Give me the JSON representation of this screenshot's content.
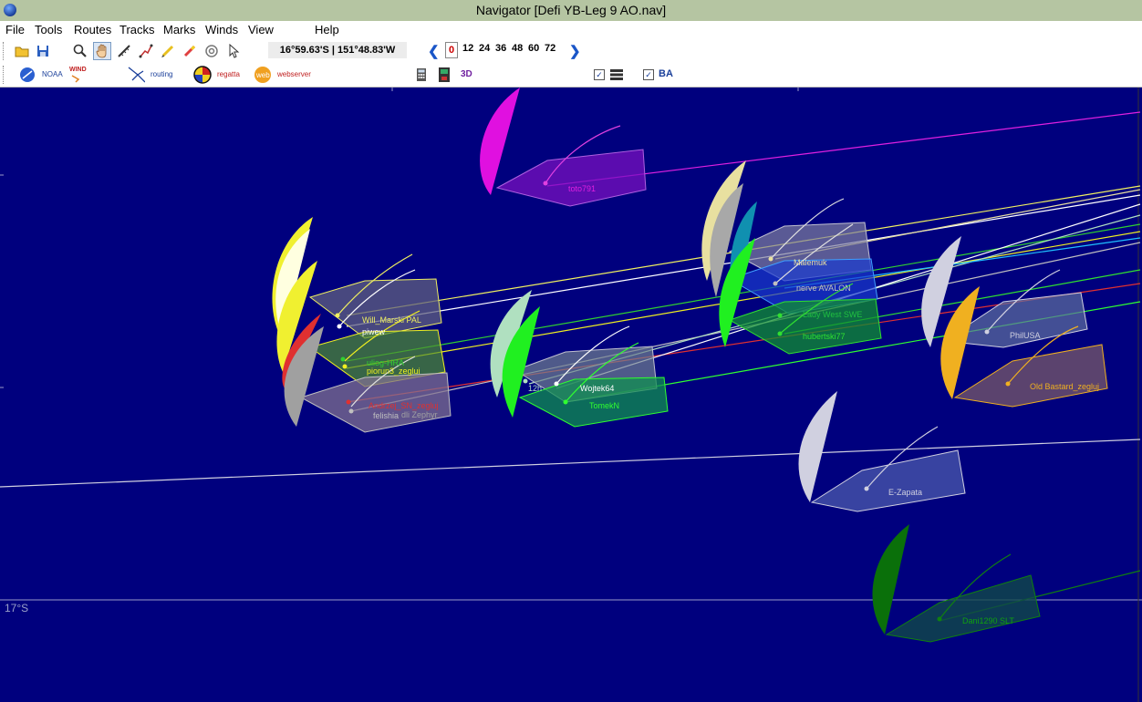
{
  "window": {
    "title": "Navigator [Defi YB-Leg 9 AO.nav]"
  },
  "menu": [
    "File",
    "Tools",
    "Routes",
    "Tracks",
    "Marks",
    "Winds",
    "View",
    "Help"
  ],
  "toolbar": {
    "position_readout": "16°59.63'S | 151°48.83'W",
    "forecast_hours_selected": "0",
    "forecast_hours": [
      "12",
      "24",
      "36",
      "48",
      "60",
      "72"
    ],
    "plugins": {
      "noaa": "NOAA",
      "wind": "WIND",
      "routing": "routing",
      "regatta": "regatta",
      "webserver": "webserver",
      "view3d": "3D",
      "ba": "BA"
    }
  },
  "map": {
    "latitude_label": "17°S",
    "background": "#00007e",
    "boats": [
      {
        "name": "toto791",
        "color": "#e020e0"
      },
      {
        "name": "Malemuk",
        "color": "#e8e0a0"
      },
      {
        "name": "nerve AVALON",
        "color": "#a8a8a8"
      },
      {
        "name": "Lady West SWE",
        "color": "#20c040"
      },
      {
        "name": "hubertski77",
        "color": "#30e030"
      },
      {
        "name": "Will_Marski PAL",
        "color": "#f0f060"
      },
      {
        "name": "piwew",
        "color": "#ffffff"
      },
      {
        "name": "uliog-HRA",
        "color": "#30d030"
      },
      {
        "name": "piorun3_zeglui",
        "color": "#f0f020"
      },
      {
        "name": "Andrzej_SN_zegluj",
        "color": "#e03030"
      },
      {
        "name": "felishia",
        "color": "#c0c0c0"
      },
      {
        "name": "dli Zephyr",
        "color": "#a0a0a0"
      },
      {
        "name": "12h",
        "color": "#b0e0c0"
      },
      {
        "name": "Wojtek64",
        "color": "#ffffff"
      },
      {
        "name": "TomekN",
        "color": "#30ff30"
      },
      {
        "name": "PhilUSA",
        "color": "#d0d0e0"
      },
      {
        "name": "Old Bastard_zegluj",
        "color": "#f0b020"
      },
      {
        "name": "E-Zapata",
        "color": "#d0d0e0"
      },
      {
        "name": "Dani1290 SLT",
        "color": "#108010"
      }
    ]
  }
}
